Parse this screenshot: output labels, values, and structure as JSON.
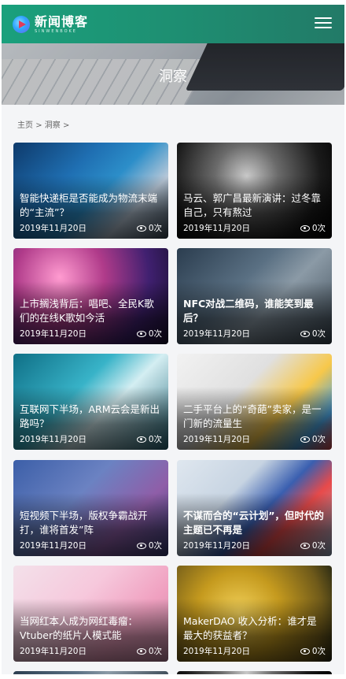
{
  "header": {
    "logo_cn": "新闻博客",
    "logo_en": "SINWENBOKE"
  },
  "banner": {
    "title": "洞察"
  },
  "breadcrumb": {
    "home": "主页",
    "sep1": ">",
    "current": "洞察",
    "sep2": ">"
  },
  "articles": [
    {
      "title": "智能快递柜是否能成为物流末端的“主流”？",
      "date": "2019年11月20日",
      "views": "0次"
    },
    {
      "title": "马云、郭广昌最新演讲：过冬靠自己，只有熬过",
      "date": "2019年11月20日",
      "views": "0次"
    },
    {
      "title": "上市搁浅背后：唱吧、全民K歌们的在线K歌如今活",
      "date": "2019年11月20日",
      "views": "0次"
    },
    {
      "title": "NFC对战二维码，谁能笑到最后？",
      "date": "2019年11月20日",
      "views": "0次"
    },
    {
      "title": "互联网下半场，ARM云会是新出路吗？",
      "date": "2019年11月20日",
      "views": "0次"
    },
    {
      "title": "二手平台上的“奇葩”卖家，是一门新的流量生",
      "date": "2019年11月20日",
      "views": "0次"
    },
    {
      "title": "短视频下半场，版权争霸战开打，谁将首发”阵",
      "date": "2019年11月20日",
      "views": "0次"
    },
    {
      "title": "不谋而合的“云计划”，但时代的主题已不再是",
      "date": "2019年11月20日",
      "views": "0次"
    },
    {
      "title": "当网红本人成为网红毒瘤：Vtuber的纸片人模式能",
      "date": "2019年11月20日",
      "views": "0次"
    },
    {
      "title": "MakerDAO 收入分析：谁才是最大的获益者？",
      "date": "2019年11月20日",
      "views": "0次"
    }
  ]
}
